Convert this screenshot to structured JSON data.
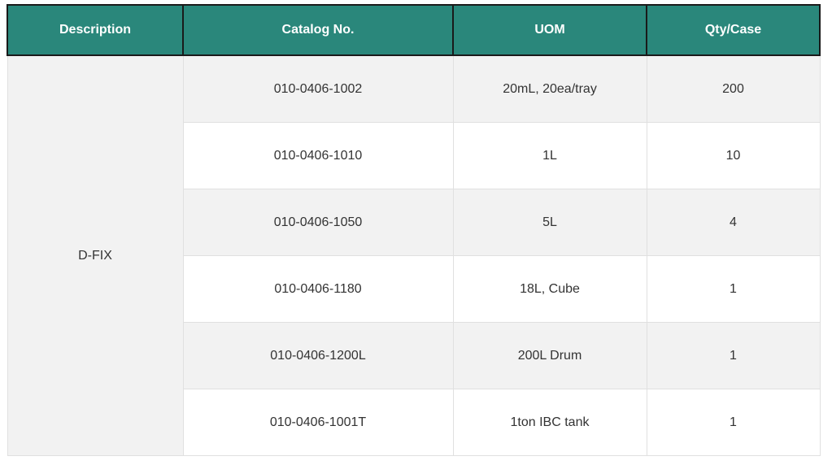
{
  "table": {
    "headers": [
      "Description",
      "Catalog No.",
      "UOM",
      "Qty/Case"
    ],
    "description": "D-FIX",
    "rows": [
      {
        "catalog": "010-0406-1002",
        "uom": "20mL, 20ea/tray",
        "qty": "200"
      },
      {
        "catalog": "010-0406-1010",
        "uom": "1L",
        "qty": "10"
      },
      {
        "catalog": "010-0406-1050",
        "uom": "5L",
        "qty": "4"
      },
      {
        "catalog": "010-0406-1180",
        "uom": "18L, Cube",
        "qty": "1"
      },
      {
        "catalog": "010-0406-1200L",
        "uom": "200L Drum",
        "qty": "1"
      },
      {
        "catalog": "010-0406-1001T",
        "uom": "1ton IBC tank",
        "qty": "1"
      }
    ]
  },
  "colors": {
    "header_bg": "#2a877b",
    "header_text": "#ffffff",
    "row_shade": "#f2f2f2",
    "row_plain": "#ffffff"
  }
}
